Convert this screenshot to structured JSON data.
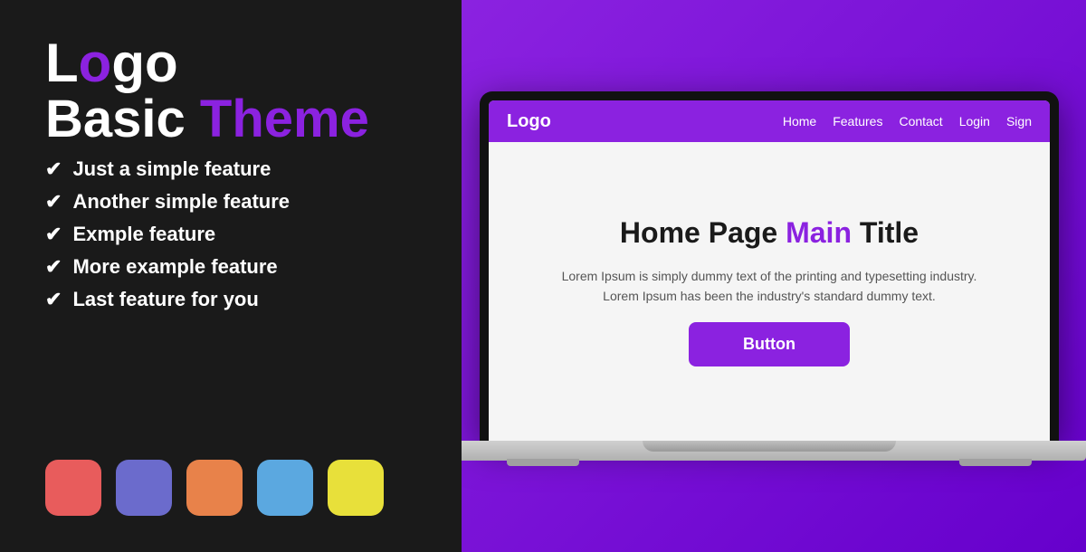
{
  "left": {
    "logo_text": "Logo",
    "logo_highlight": "o",
    "subtitle_plain": "Basic ",
    "subtitle_highlight": "Theme",
    "features": [
      "Just a simple feature",
      "Another simple feature",
      "Exmple feature",
      "More example feature",
      "Last feature for you"
    ],
    "swatches": [
      {
        "color": "#e85c5c",
        "name": "red"
      },
      {
        "color": "#6b6bcc",
        "name": "purple"
      },
      {
        "color": "#e8824a",
        "name": "orange"
      },
      {
        "color": "#5ba8e0",
        "name": "blue"
      },
      {
        "color": "#e8e03a",
        "name": "yellow"
      }
    ]
  },
  "browser": {
    "nav": {
      "logo": "Logo",
      "links": [
        "Home",
        "Features",
        "Contact",
        "Login",
        "Sign"
      ]
    },
    "content": {
      "title_plain": "Home Page ",
      "title_highlight": "Main",
      "title_end": " Title",
      "description": "Lorem Ipsum is simply dummy text of the printing and typesetting industry.\nLorem Ipsum has been the industry's standard dummy text.",
      "button_label": "Button"
    }
  }
}
